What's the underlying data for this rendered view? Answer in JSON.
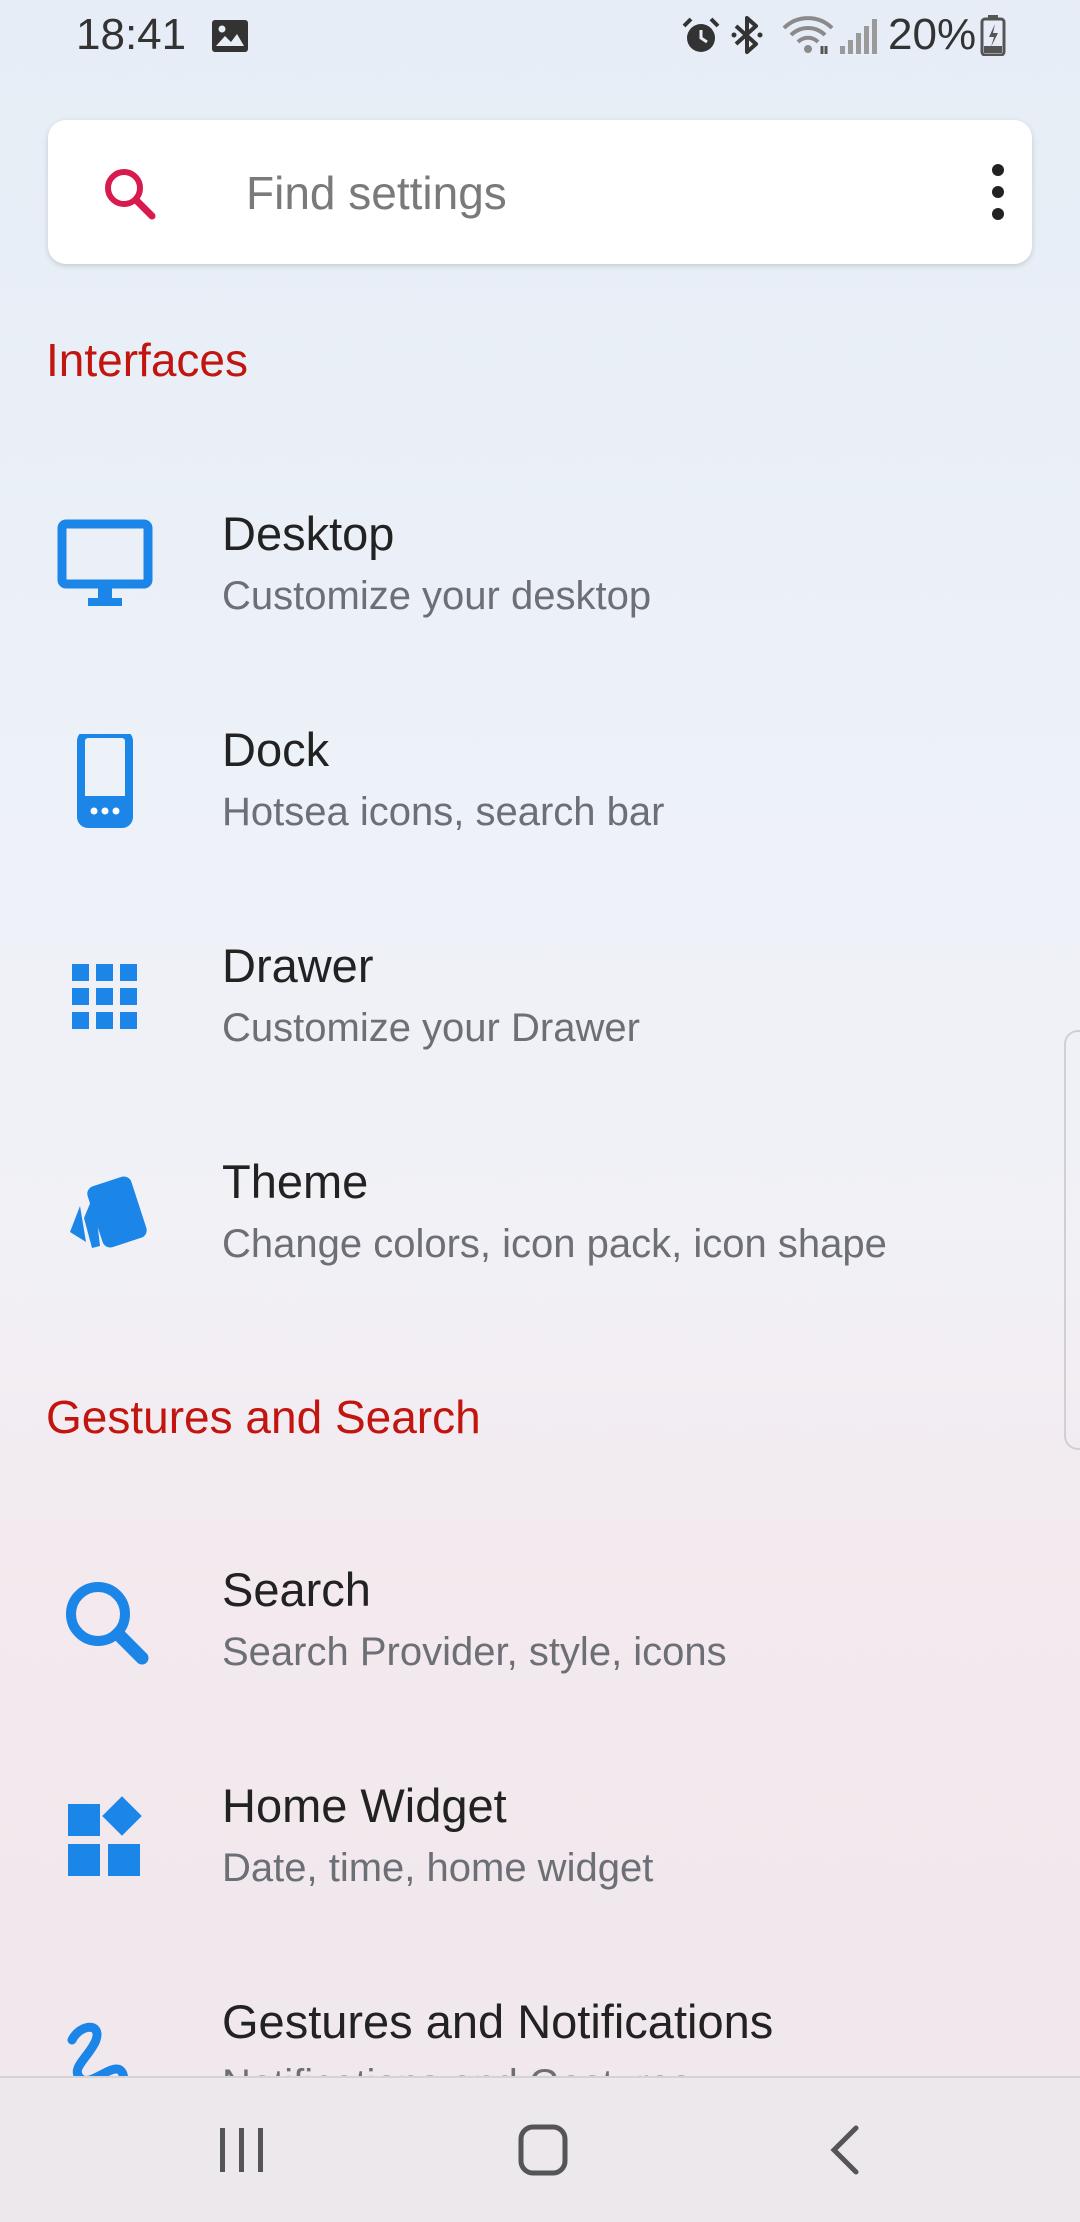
{
  "status_bar": {
    "time": "18:41",
    "battery": "20%",
    "icons": [
      "image-icon",
      "alarm-icon",
      "bluetooth-icon",
      "wifi-icon",
      "signal-icon",
      "battery-icon"
    ]
  },
  "search": {
    "placeholder": "Find settings",
    "icon": "search-icon",
    "menu_icon": "more-vert-icon"
  },
  "sections": [
    {
      "heading": "Interfaces",
      "items": [
        {
          "title": "Desktop",
          "subtitle": "Customize your desktop",
          "icon": "desktop-icon"
        },
        {
          "title": "Dock",
          "subtitle": "Hotsea icons, search bar",
          "icon": "phone-icon"
        },
        {
          "title": "Drawer",
          "subtitle": "Customize your Drawer",
          "icon": "grid-icon"
        },
        {
          "title": "Theme",
          "subtitle": "Change colors, icon pack, icon shape",
          "icon": "theme-cards-icon"
        }
      ]
    },
    {
      "heading": "Gestures and Search",
      "items": [
        {
          "title": "Search",
          "subtitle": "Search Provider, style, icons",
          "icon": "search-icon"
        },
        {
          "title": "Home Widget",
          "subtitle": "Date, time, home widget",
          "icon": "widgets-icon"
        },
        {
          "title": "Gestures and Notifications",
          "subtitle": "Notifications and Gestures",
          "icon": "gesture-icon"
        }
      ]
    }
  ],
  "nav_bar": {
    "buttons": [
      "recent-apps-icon",
      "home-icon",
      "back-icon"
    ]
  },
  "colors": {
    "accent_red": "#c2150f",
    "search_icon_pink": "#d81b4f",
    "icon_blue": "#1b86e8",
    "title_text": "#222222",
    "subtitle_text": "#6c6f75"
  }
}
